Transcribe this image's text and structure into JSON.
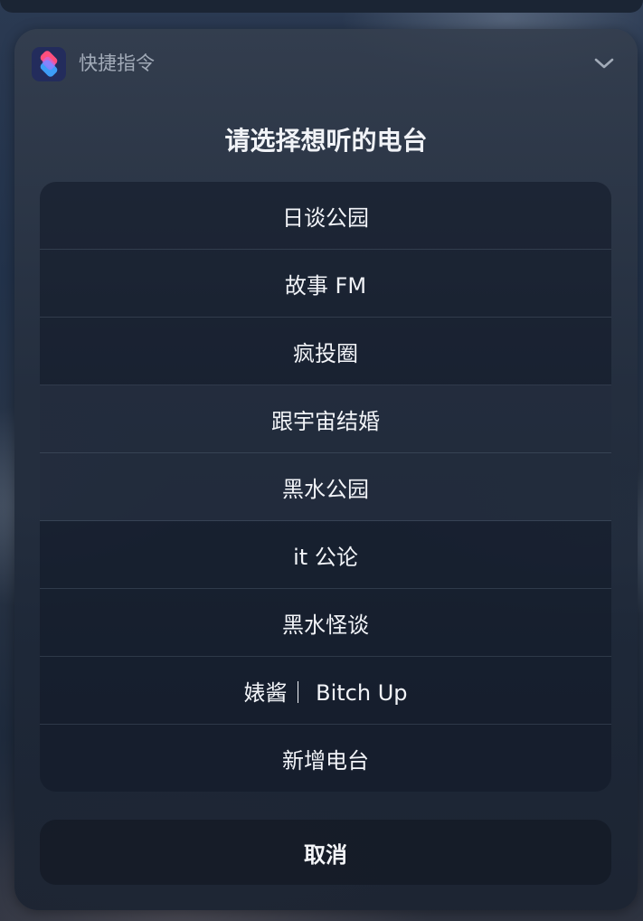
{
  "header": {
    "app_name": "快捷指令",
    "app_icon": "shortcuts-icon",
    "collapse_icon": "chevron-down-icon"
  },
  "dialog": {
    "title": "请选择想听的电台",
    "options": [
      "日谈公园",
      "故事 FM",
      "疯投圈",
      "跟宇宙结婚",
      "黑水公园",
      "it 公论",
      "黑水怪谈",
      "婊酱｜ Bitch Up",
      "新增电台"
    ],
    "cancel_label": "取消"
  },
  "colors": {
    "icon_pink": "#ff5a8a",
    "icon_blue": "#4aa8ff",
    "icon_bg": "#232c5c"
  }
}
